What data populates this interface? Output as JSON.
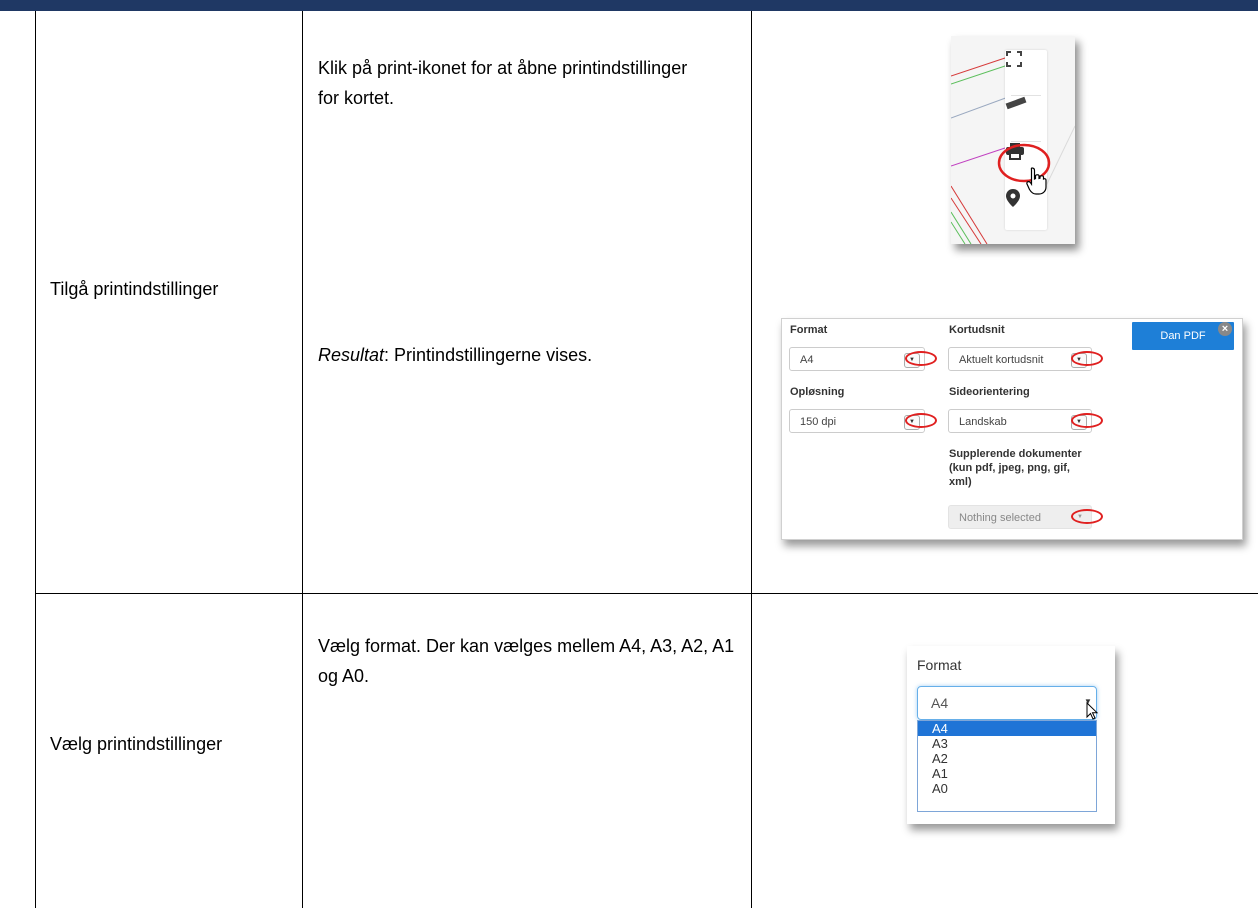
{
  "table": {
    "rows": [
      {
        "step": "Tilgå printindstillinger",
        "instruction": "Klik på print-ikonet for at åbne printindstillinger for kortet.",
        "result_label": "Resultat",
        "result_text": ": Printindstillingerne vises."
      },
      {
        "step": "Vælg printindstillinger",
        "instruction": "Vælg format. Der kan vælges mellem A4, A3, A2, A1 og A0."
      }
    ]
  },
  "toolbar_shot": {
    "buttons": [
      "fullscreen-icon",
      "ruler-icon",
      "print-icon",
      "location-pin-icon"
    ],
    "highlight_color": "#e02020"
  },
  "print_panel": {
    "format_label": "Format",
    "format_value": "A4",
    "kortudsnit_label": "Kortudsnit",
    "kortudsnit_value": "Aktuelt kortudsnit",
    "oplosning_label": "Opløsning",
    "oplosning_value": "150 dpi",
    "sideorientering_label": "Sideorientering",
    "sideorientering_value": "Landskab",
    "supplerende_label": "Supplerende dokumenter (kun pdf, jpeg, png, gif, xml)",
    "supplerende_value": "Nothing selected",
    "button_label": "Dan PDF",
    "accent_color": "#1e7fd7"
  },
  "format_dropdown": {
    "label": "Format",
    "selected": "A4",
    "options": [
      "A4",
      "A3",
      "A2",
      "A1",
      "A0"
    ]
  }
}
